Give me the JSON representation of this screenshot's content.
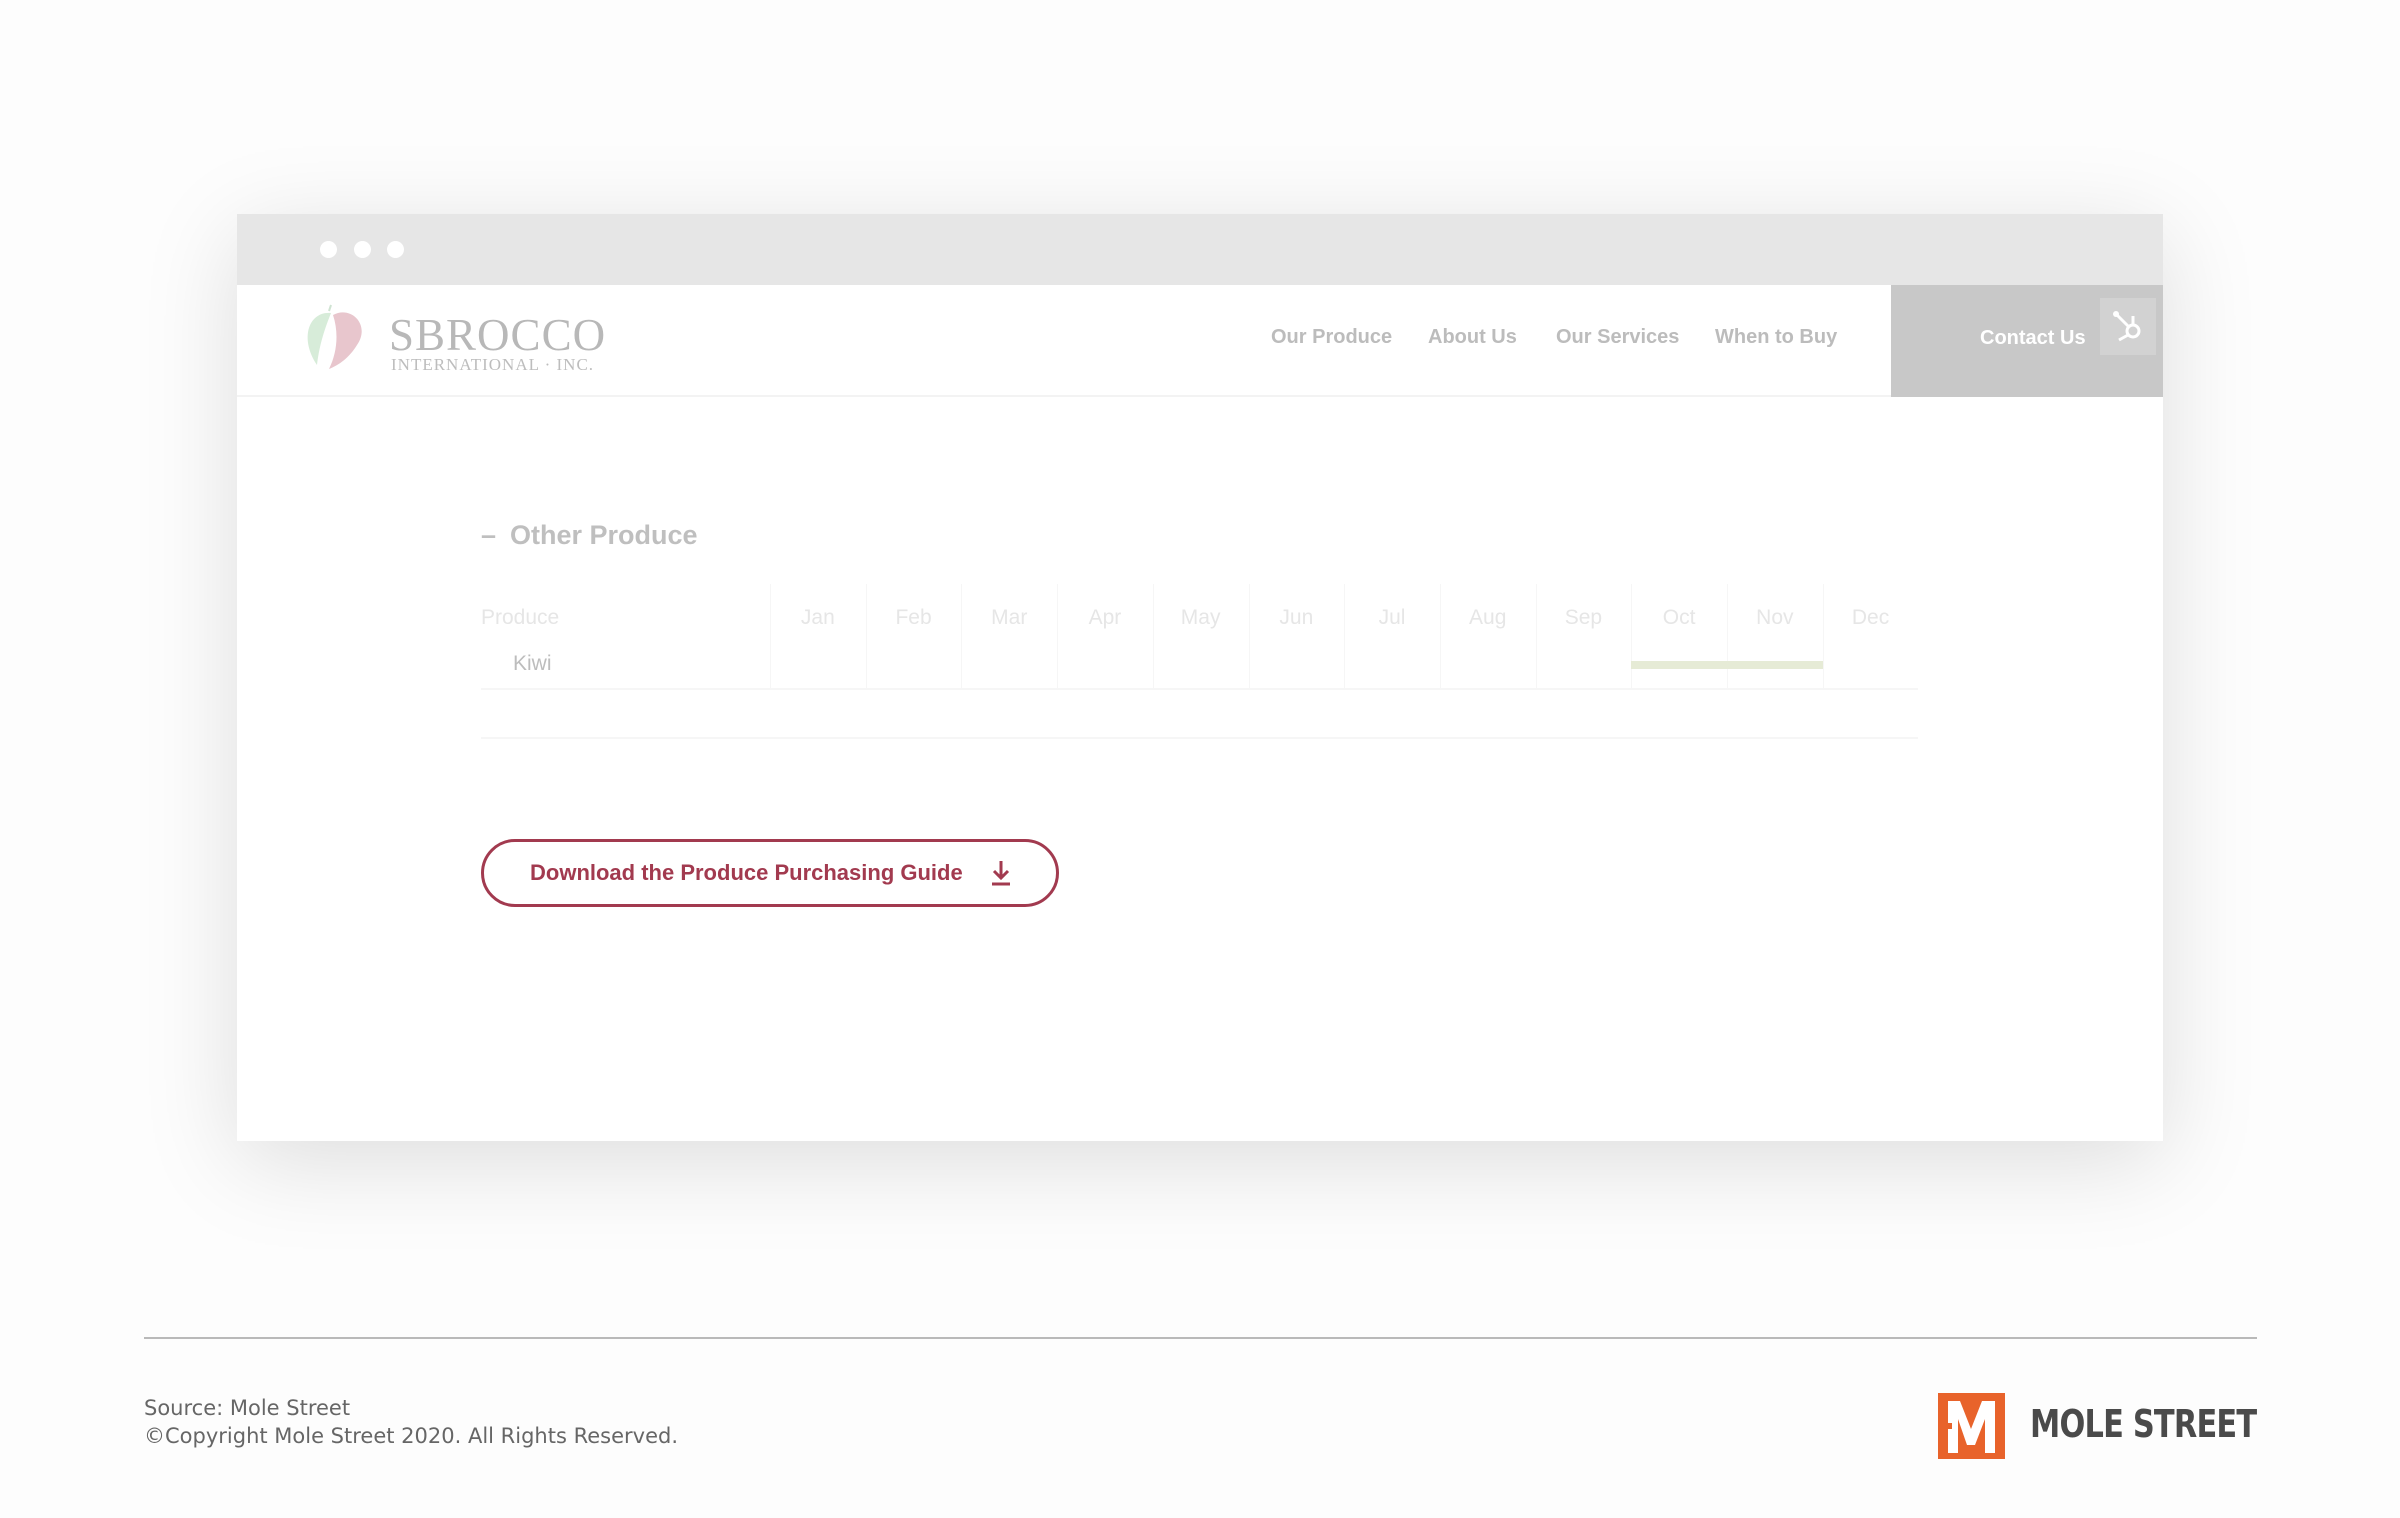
{
  "browser": {
    "dots": 3
  },
  "site": {
    "logo": {
      "name": "SBROCCO",
      "sub": "INTERNATIONAL · INC."
    },
    "nav": [
      {
        "label": "Our Produce"
      },
      {
        "label": "About Us"
      },
      {
        "label": "Our Services"
      },
      {
        "label": "When to Buy"
      }
    ],
    "contact_label": "Contact Us",
    "hubspot_icon": "hubspot-sprocket-icon"
  },
  "section": {
    "toggle": "–",
    "title": "Other Produce",
    "table": {
      "header": "Produce",
      "months": [
        "Jan",
        "Feb",
        "Mar",
        "Apr",
        "May",
        "Jun",
        "Jul",
        "Aug",
        "Sep",
        "Oct",
        "Nov",
        "Dec"
      ],
      "rows": [
        {
          "name": "Kiwi",
          "available_months": [
            "Oct",
            "Nov"
          ],
          "bar_color": "#e6ebd6"
        }
      ]
    },
    "download_label": "Download the Produce Purchasing Guide",
    "download_icon": "download-icon",
    "accent": "#a23a4f"
  },
  "footer": {
    "source": "Source: Mole Street",
    "copyright": "©Copyright Mole Street 2020. All Rights Reserved.",
    "brand": "MOLE STREET",
    "brand_color": "#e8632b"
  }
}
